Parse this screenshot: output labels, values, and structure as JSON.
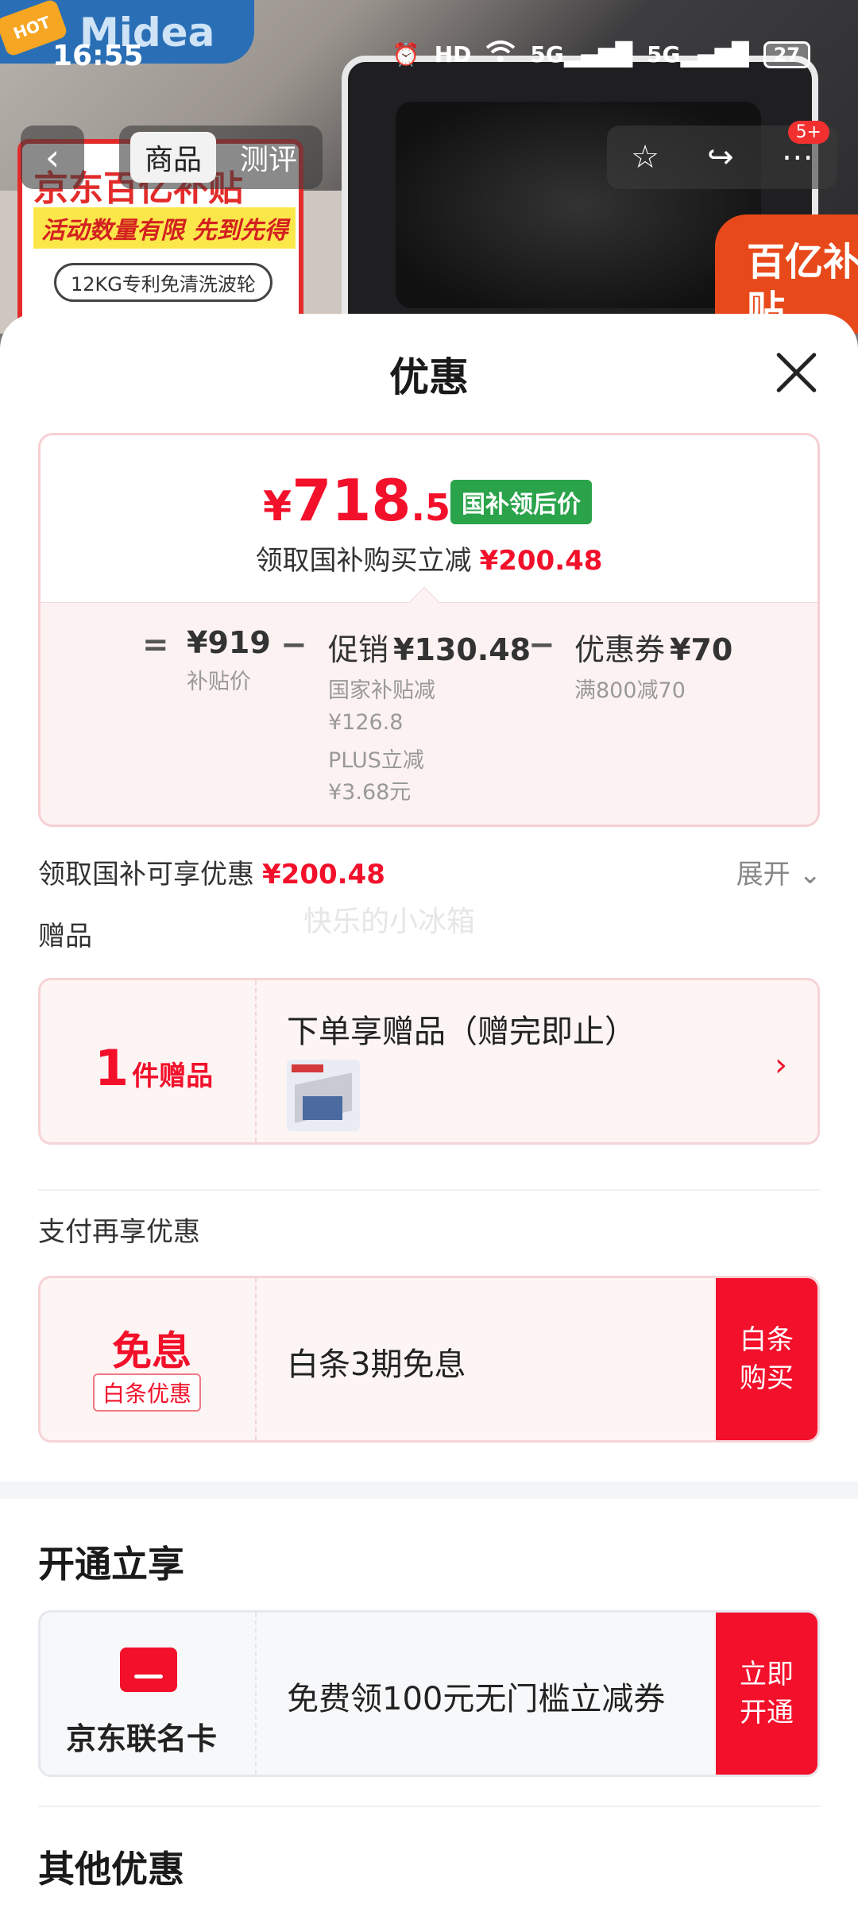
{
  "status_bar": {
    "time": "16:55",
    "network": "5G",
    "battery": "27"
  },
  "background": {
    "brand": "Midea",
    "hot_badge": "HOT",
    "promo_title": "京东百亿补贴",
    "promo_subtitle": "活动数量有限 先到先得",
    "promo_feature": "12KG专利免清洗波轮",
    "bonus_badge": "百亿补贴"
  },
  "nav": {
    "tabs": [
      {
        "label": "商品"
      },
      {
        "label": "测评"
      }
    ],
    "badge": "5+"
  },
  "sheet": {
    "title": "优惠",
    "final_price": {
      "yen": "¥",
      "integer": "718",
      "decimal": ".52",
      "tag": "国补领后价"
    },
    "saving": {
      "label": "领取国补购买立减",
      "amount": "¥200.48"
    },
    "breakdown": {
      "eq": "=",
      "base": {
        "value": "¥919",
        "sub": "补贴价"
      },
      "minus1": "−",
      "promo": {
        "label": "促销",
        "value": "¥130.48",
        "sub1": "国家补贴减",
        "sub2": "¥126.8",
        "sub3": "PLUS立减",
        "sub4": "¥3.68元"
      },
      "minus2": "−",
      "coupon": {
        "label": "优惠券",
        "value": "¥70",
        "sub": "满800减70"
      }
    },
    "summary": {
      "label": "领取国补可享优惠",
      "amount": "¥200.48",
      "expand": "展开"
    },
    "watermark": "快乐的小冰箱",
    "gift_section": {
      "label": "赠品",
      "count": "1",
      "unit": "件赠品",
      "title": "下单享赠品（赠完即止）"
    },
    "pay_section": {
      "label": "支付再享优惠",
      "title": "免息",
      "tag": "白条优惠",
      "text": "白条3期免息",
      "cta": "白条购买"
    },
    "open_section": {
      "heading": "开通立享",
      "card_name": "京东联名卡",
      "text": "免费领100元无门槛立减券",
      "cta": "立即开通"
    },
    "other_section": {
      "heading": "其他优惠"
    }
  },
  "colors": {
    "accent_red": "#f2102a",
    "tag_green": "#2aa34a"
  }
}
